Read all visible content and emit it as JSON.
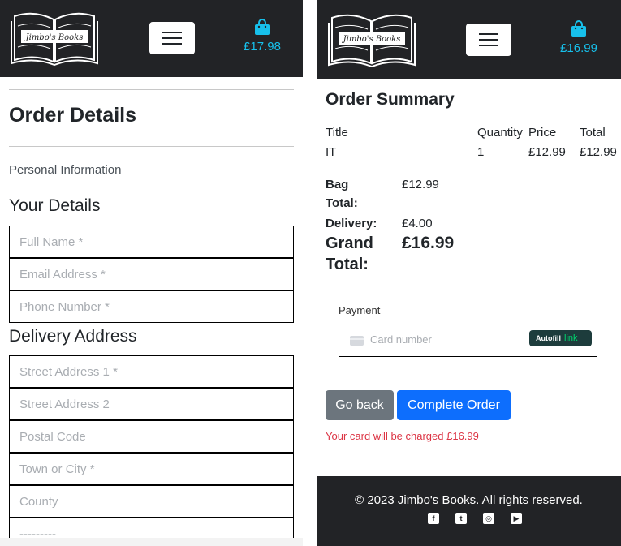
{
  "left": {
    "brand": {
      "logo_text": "Jimbo's Books"
    },
    "header": {
      "bag_total": "£17.98",
      "bag_icon": "shopping-bag-icon",
      "menu_icon": "hamburger-icon"
    },
    "page_title": "Order Details",
    "section_label": "Personal Information",
    "your_details": {
      "heading": "Your Details",
      "full_name_placeholder": "Full Name *",
      "email_placeholder": "Email Address *",
      "phone_placeholder": "Phone Number *"
    },
    "delivery_address": {
      "heading": "Delivery Address",
      "street1_placeholder": "Street Address 1 *",
      "street2_placeholder": "Street Address 2",
      "postcode_placeholder": "Postal Code",
      "town_placeholder": "Town or City *",
      "county_placeholder": "County",
      "country_placeholder": "---------"
    }
  },
  "right": {
    "brand": {
      "logo_text": "Jimbo's Books"
    },
    "header": {
      "bag_total": "£16.99",
      "bag_icon": "shopping-bag-icon",
      "menu_icon": "hamburger-icon"
    },
    "summary": {
      "heading": "Order Summary",
      "columns": [
        "Title",
        "Quantity",
        "Price",
        "Total"
      ],
      "rows": [
        {
          "title": "IT",
          "quantity": "1",
          "price": "£12.99",
          "total": "£12.99"
        }
      ],
      "bag_total_label": "Bag Total:",
      "bag_total_value": "£12.99",
      "delivery_label": "Delivery:",
      "delivery_value": "£4.00",
      "grand_total_label": "Grand Total:",
      "grand_total_value": "£16.99"
    },
    "payment": {
      "label": "Payment",
      "card_placeholder": "Card number",
      "autofill_label": "Autofill",
      "autofill_link": "link"
    },
    "actions": {
      "back_label": "Go back",
      "complete_label": "Complete Order",
      "charge_message": "Your card will be charged £16.99"
    },
    "footer": {
      "copyright": "© 2023 Jimbo's Books. All rights reserved.",
      "social_icons": [
        "facebook-icon",
        "twitter-icon",
        "instagram-icon",
        "youtube-icon"
      ]
    }
  },
  "colors": {
    "navbar": "#222326",
    "bag_accent": "#17c0eb",
    "button_secondary": "#6c757d",
    "button_primary": "#0d6efd",
    "danger_text": "#dc3545",
    "autofill_bg": "#1d3c3c",
    "autofill_link": "#00d66f"
  }
}
